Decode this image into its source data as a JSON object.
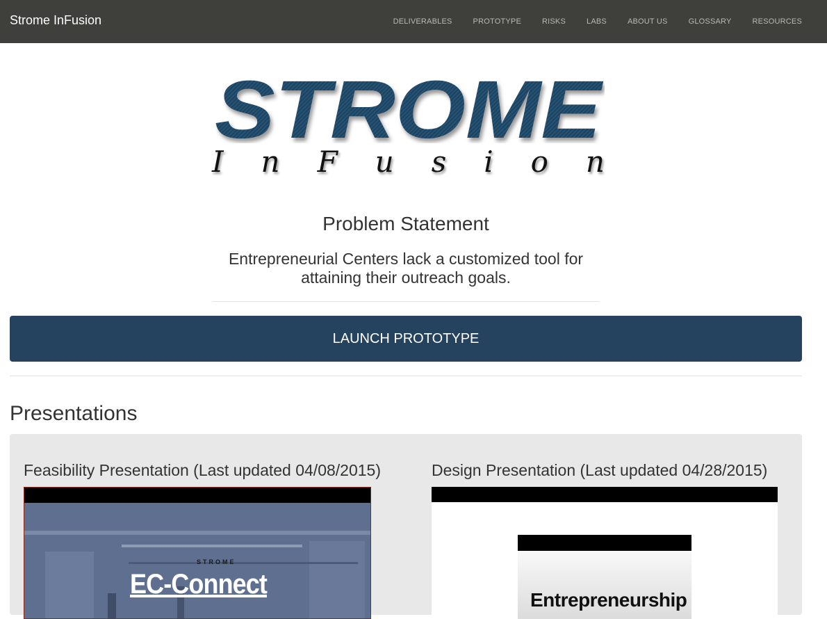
{
  "navbar": {
    "brand": "Strome InFusion",
    "items": [
      {
        "label": "DELIVERABLES"
      },
      {
        "label": "PROTOTYPE"
      },
      {
        "label": "RISKS"
      },
      {
        "label": "LABS"
      },
      {
        "label": "ABOUT US"
      },
      {
        "label": "GLOSSARY"
      },
      {
        "label": "RESOURCES"
      }
    ]
  },
  "logo": {
    "title": "STROME",
    "subtitle_letters": [
      "I",
      "n",
      "F",
      "u",
      "s",
      "i",
      "o",
      "n"
    ],
    "color": "#1f4463"
  },
  "problem": {
    "heading": "Problem Statement",
    "text": "Entrepreneurial Centers lack a customized tool for attaining their outreach goals."
  },
  "launch_button": {
    "label": "LAUNCH PROTOTYPE",
    "color": "#25435f"
  },
  "presentations": {
    "heading": "Presentations",
    "cards": [
      {
        "title": "Feasibility Presentation (Last updated 04/08/2015)",
        "slide_label": "STROME",
        "slide_title": "EC-Connect"
      },
      {
        "title": "Design Presentation (Last updated 04/28/2015)",
        "slide_title": "Entrepreneurship"
      }
    ]
  }
}
